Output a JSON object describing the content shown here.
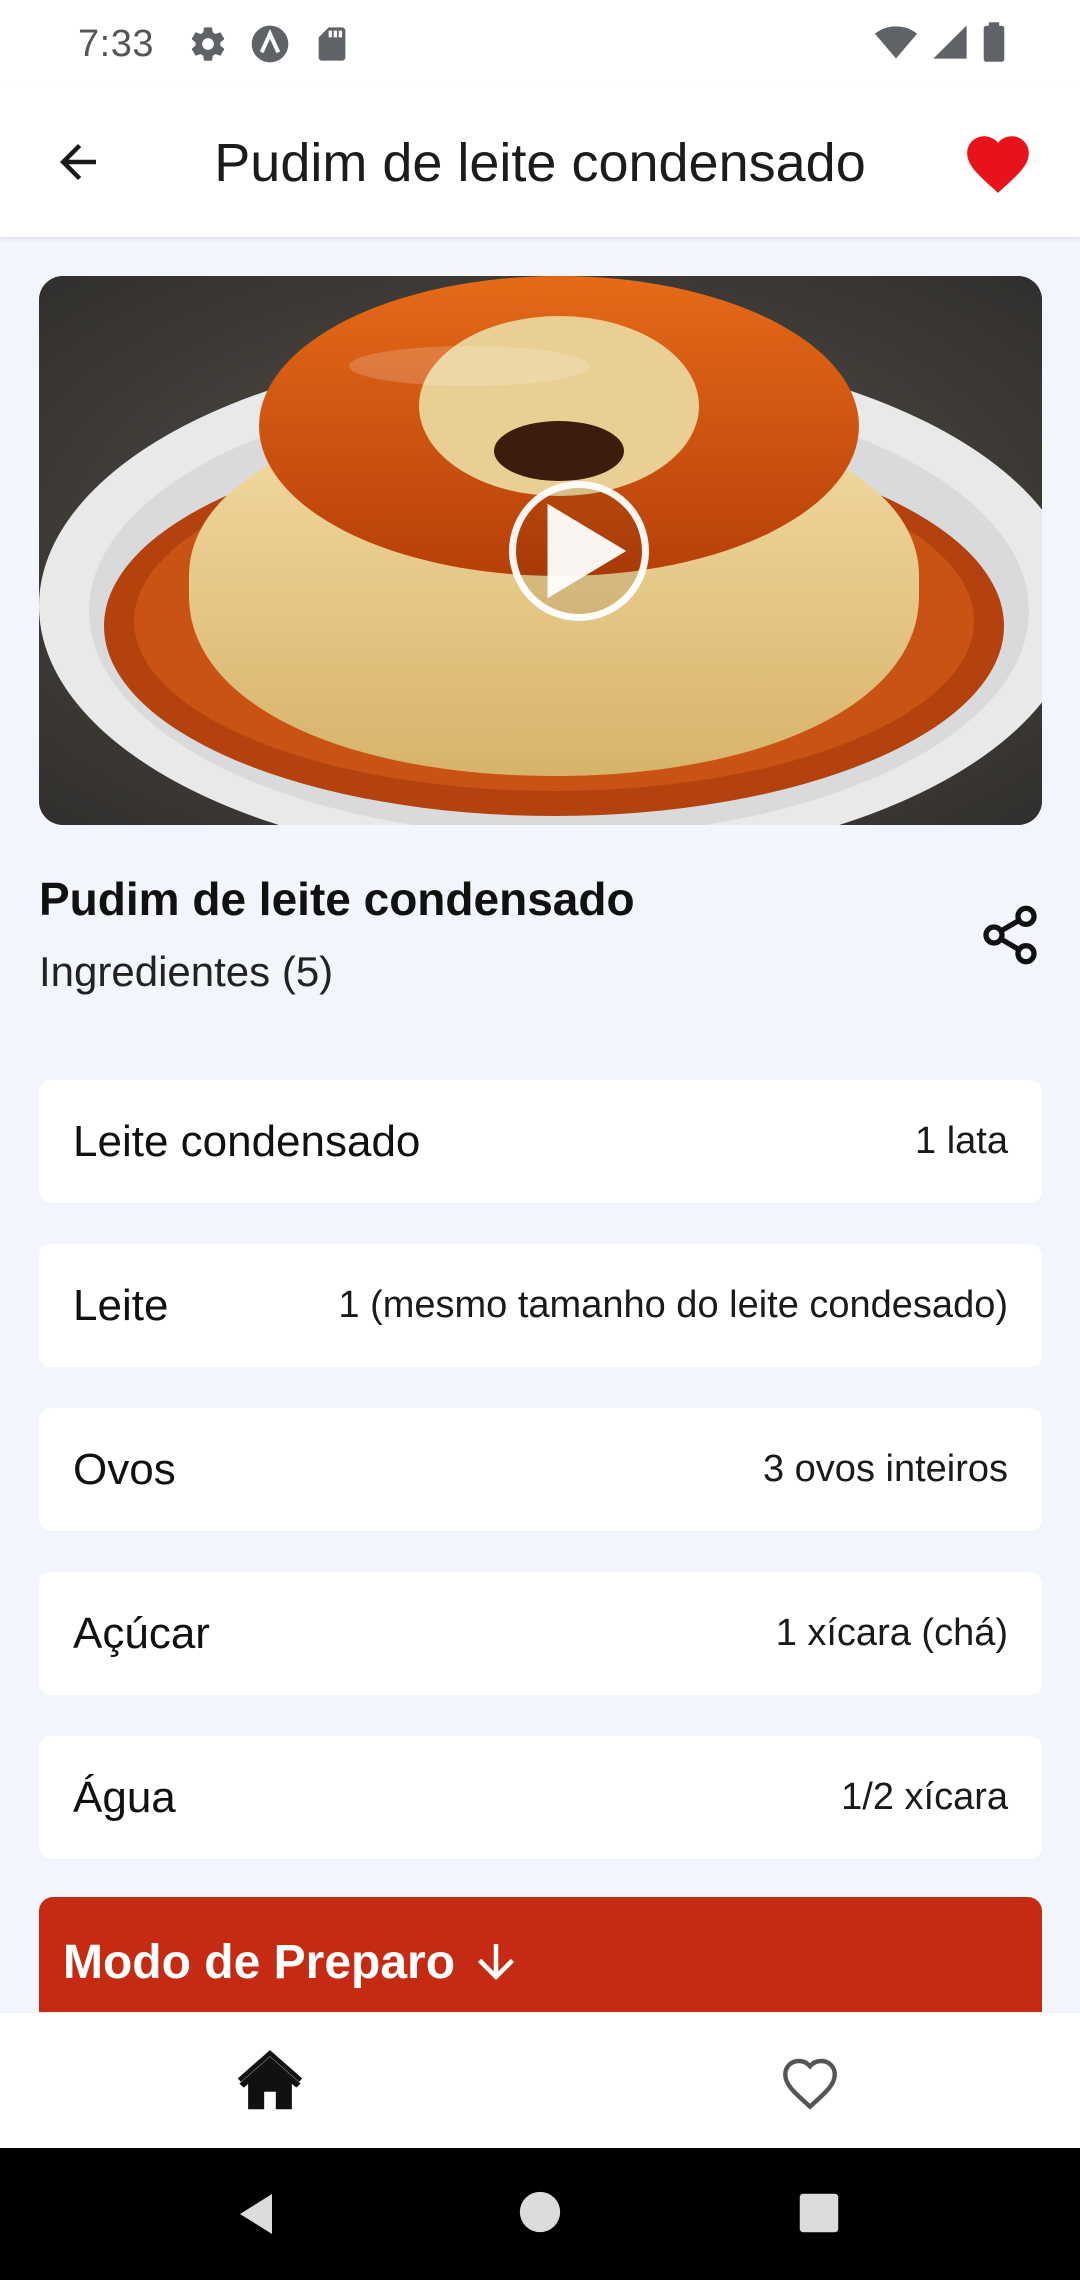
{
  "status_bar": {
    "time": "7:33",
    "icons_left": [
      "settings-icon",
      "app-a-icon",
      "sd-card-icon"
    ],
    "icons_right": [
      "wifi-icon",
      "signal-icon",
      "battery-icon"
    ]
  },
  "app_bar": {
    "title": "Pudim de leite condensado",
    "favorite_active": true,
    "favorite_color": "#e8121a"
  },
  "hero": {
    "has_video": true
  },
  "recipe": {
    "name": "Pudim de leite condensado",
    "ingredients_heading": "Ingredientes (5)",
    "ingredients": [
      {
        "name": "Leite condensado",
        "quantity": "1 lata"
      },
      {
        "name": "Leite",
        "quantity": "1 (mesmo tamanho do leite condesado)"
      },
      {
        "name": "Ovos",
        "quantity": "3 ovos inteiros"
      },
      {
        "name": "Açúcar",
        "quantity": "1 xícara (chá)"
      },
      {
        "name": "Água",
        "quantity": "1/2 xícara"
      }
    ]
  },
  "preparo": {
    "label": "Modo de Preparo",
    "color": "#c42b12"
  },
  "bottom_nav": {
    "items": [
      "home-icon",
      "heart-outline-icon"
    ]
  },
  "colors": {
    "accent": "#c42b12",
    "background": "#f2f6fc",
    "heart": "#e8121a"
  }
}
